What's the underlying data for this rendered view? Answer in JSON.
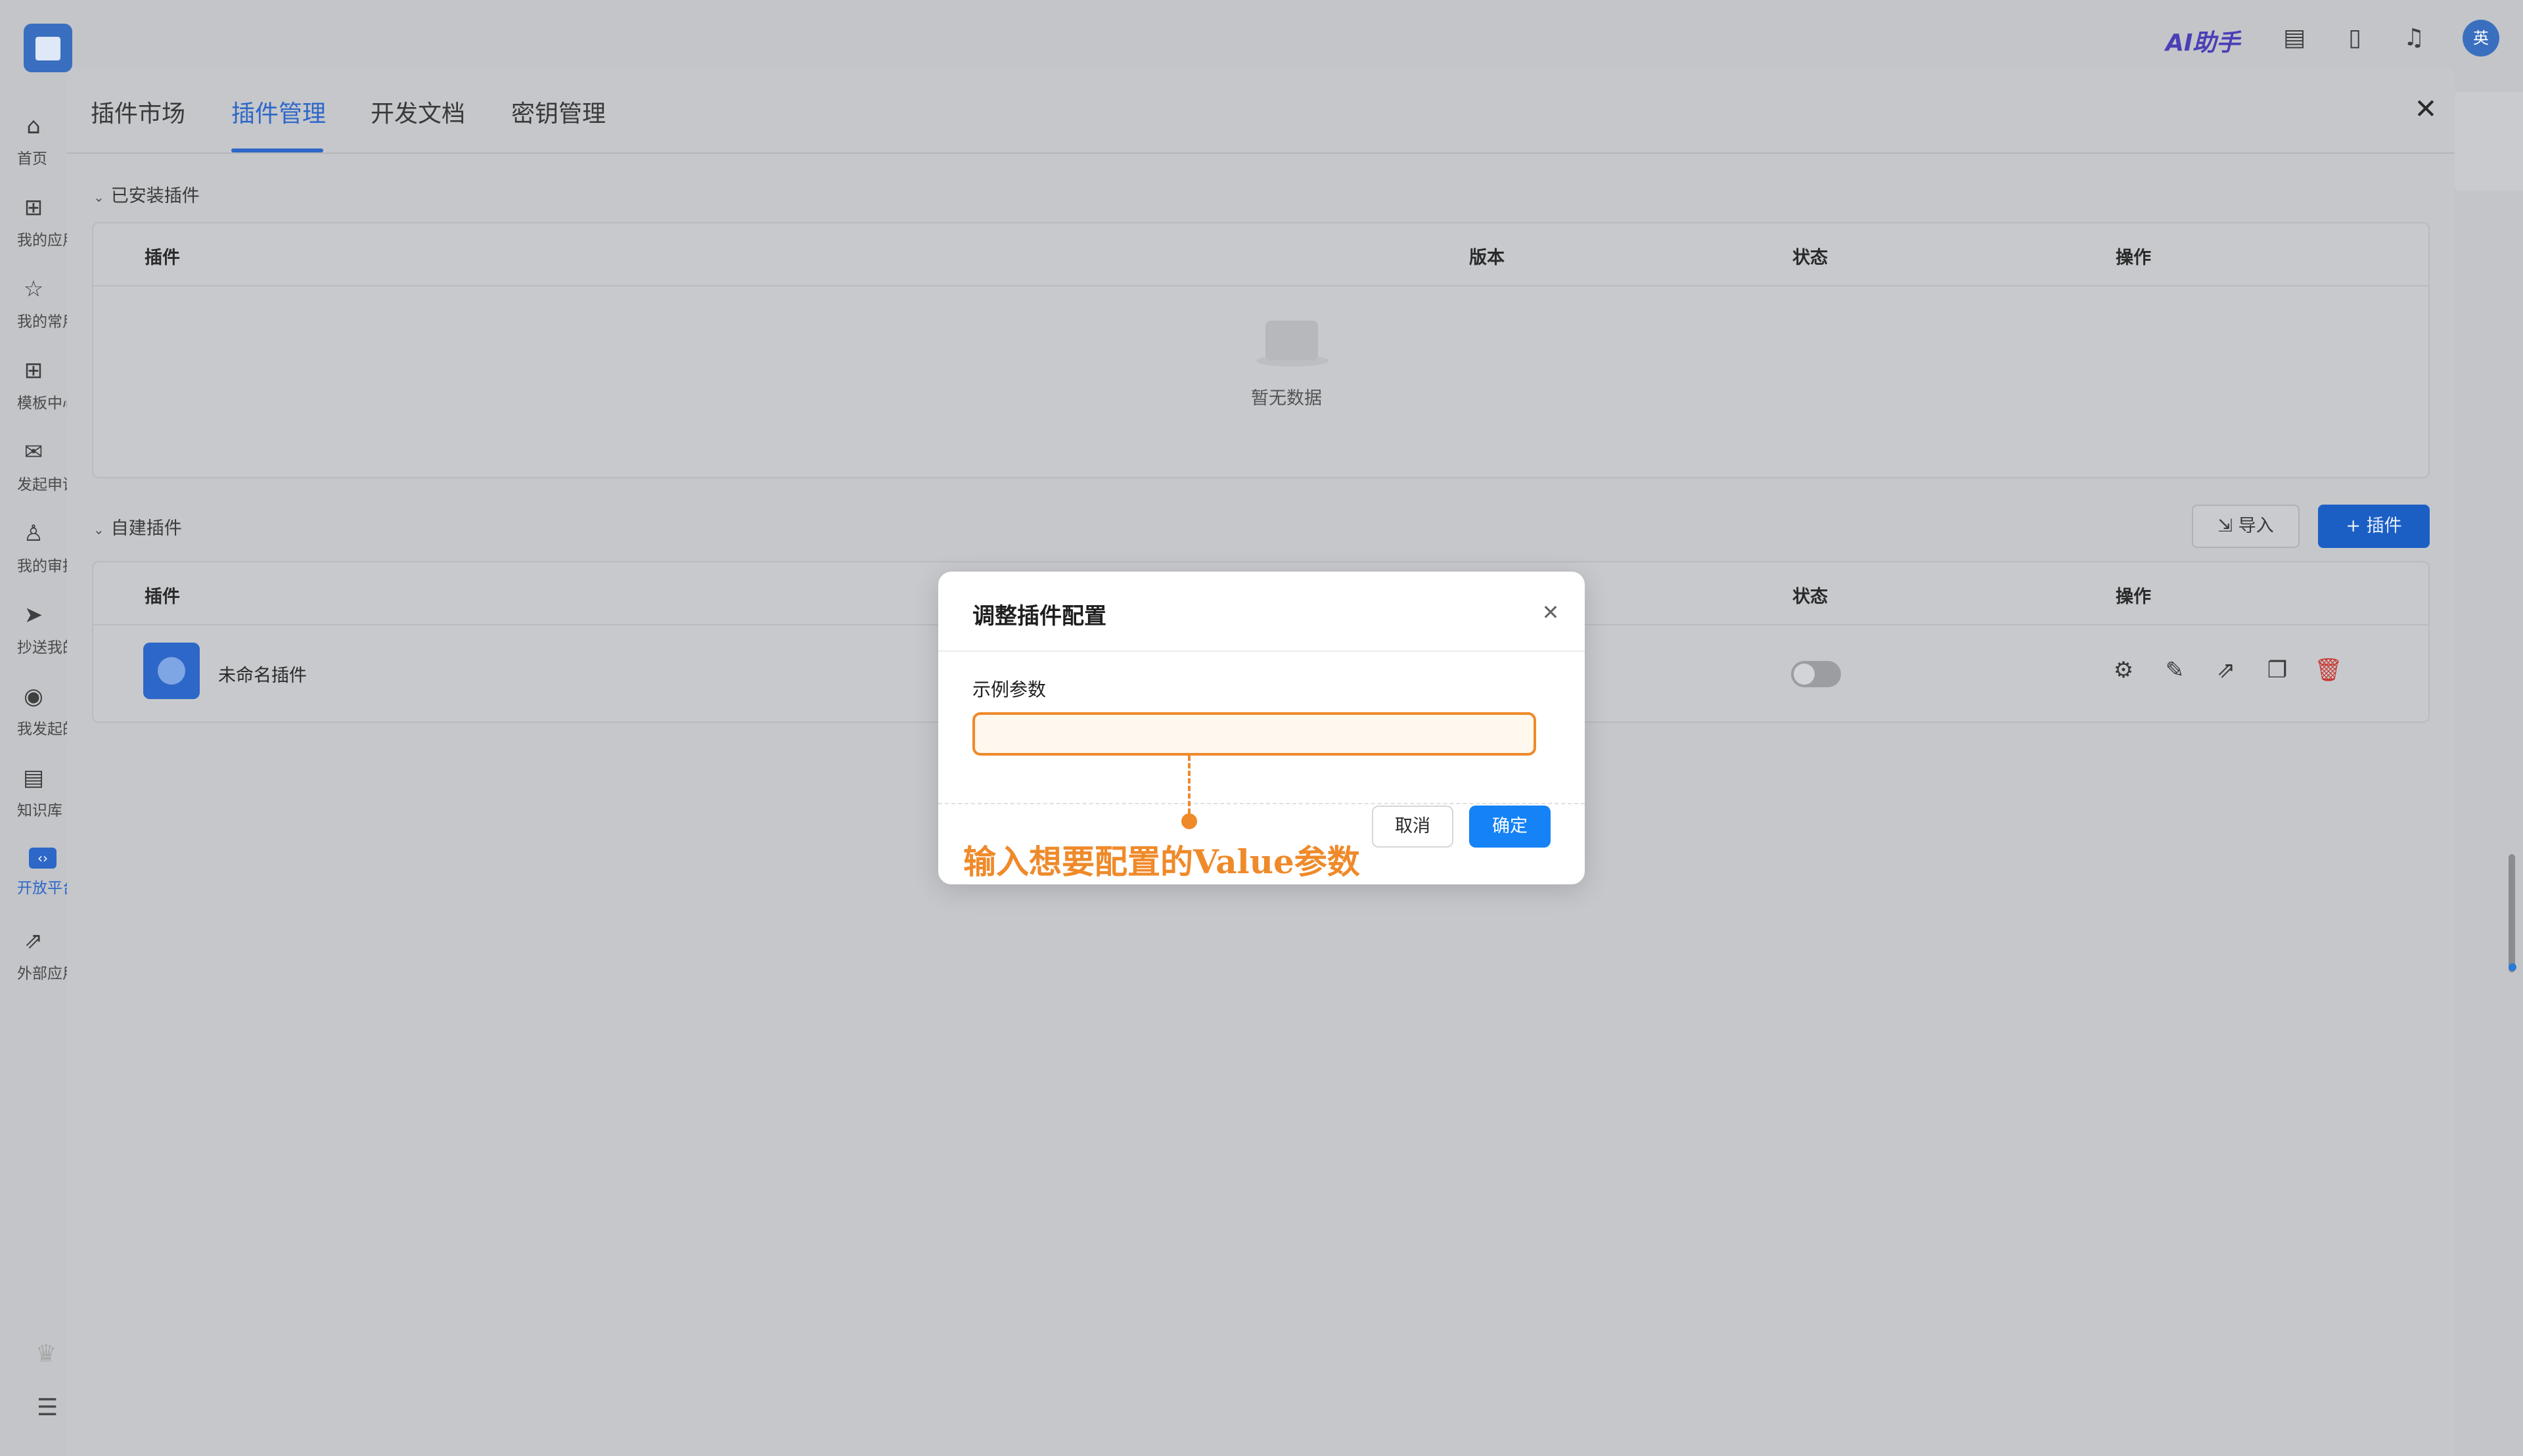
{
  "app": {
    "ai_assistant": "AI助手",
    "avatar_text": "英"
  },
  "sidebar": {
    "items": [
      {
        "label": "首页",
        "icon": "home-icon"
      },
      {
        "label": "我的应用",
        "icon": "apps-icon"
      },
      {
        "label": "我的常用",
        "icon": "star-icon"
      },
      {
        "label": "模板中心",
        "icon": "template-icon"
      },
      {
        "label": "发起申请",
        "icon": "mail-icon"
      },
      {
        "label": "我的审批",
        "icon": "user-icon"
      },
      {
        "label": "抄送我的",
        "icon": "send-icon"
      },
      {
        "label": "我发起的",
        "icon": "play-icon"
      },
      {
        "label": "知识库",
        "icon": "book-icon"
      },
      {
        "label": "开放平台",
        "icon": "code-icon"
      },
      {
        "label": "外部应用",
        "icon": "external-link-icon"
      }
    ]
  },
  "drawer": {
    "tabs": [
      {
        "label": "插件市场"
      },
      {
        "label": "插件管理"
      },
      {
        "label": "开发文档"
      },
      {
        "label": "密钥管理"
      }
    ],
    "active_tab": "插件管理",
    "installed": {
      "title": "已安装插件",
      "columns": [
        "插件",
        "版本",
        "状态",
        "操作"
      ],
      "empty_text": "暂无数据"
    },
    "custom": {
      "title": "自建插件",
      "import_label": "导入",
      "add_label": "+ 插件",
      "columns": [
        "插件",
        "状态",
        "操作"
      ],
      "rows": [
        {
          "name": "未命名插件",
          "enabled": false
        }
      ]
    }
  },
  "modal": {
    "title": "调整插件配置",
    "field_label": "示例参数",
    "field_value": "",
    "cancel_label": "取消",
    "ok_label": "确定"
  },
  "annotation": {
    "text": "输入想要配置的Value参数",
    "color": "#ef8a2a"
  },
  "colors": {
    "primary": "#1582f6",
    "accent": "#ef8a2a",
    "danger": "#c8382f"
  }
}
